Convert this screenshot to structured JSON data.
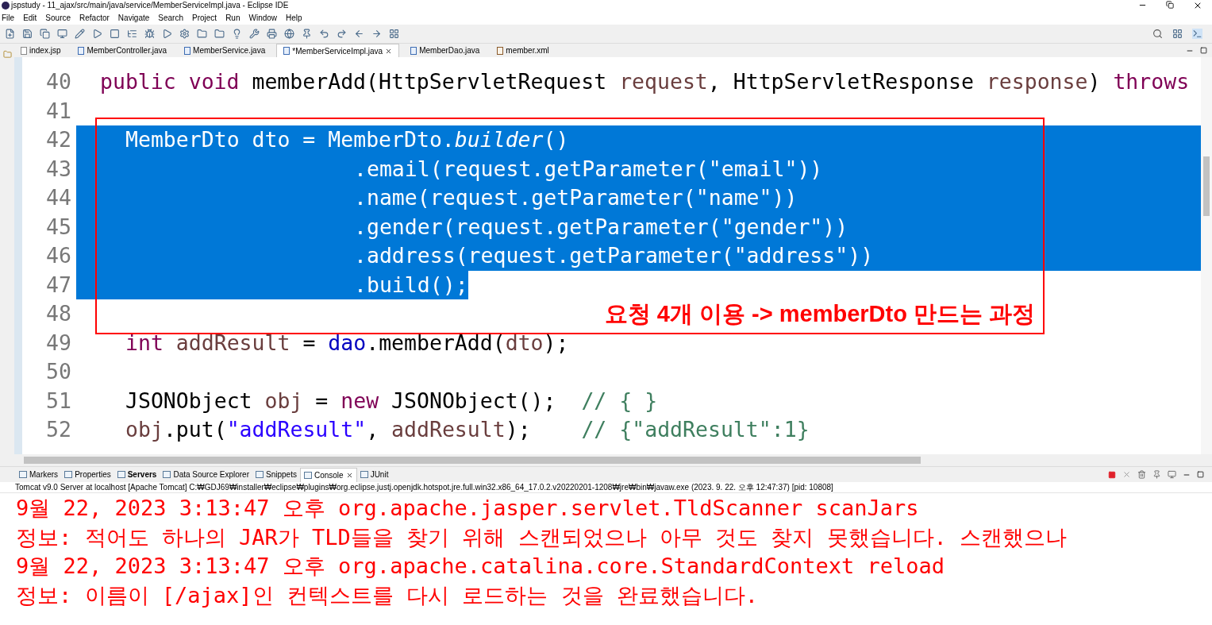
{
  "window": {
    "title": "jspstudy - 11_ajax/src/main/java/service/MemberServiceImpl.java - Eclipse IDE"
  },
  "menu": [
    "File",
    "Edit",
    "Source",
    "Refactor",
    "Navigate",
    "Search",
    "Project",
    "Run",
    "Window",
    "Help"
  ],
  "editor_tabs": [
    {
      "label": "index.jsp",
      "kind": "jsp",
      "selected": false
    },
    {
      "label": "MemberController.java",
      "kind": "java",
      "selected": false
    },
    {
      "label": "MemberService.java",
      "kind": "java",
      "selected": false
    },
    {
      "label": "*MemberServiceImpl.java",
      "kind": "java",
      "selected": true
    },
    {
      "label": "MemberDao.java",
      "kind": "java",
      "selected": false
    },
    {
      "label": "member.xml",
      "kind": "xml",
      "selected": false
    }
  ],
  "code_lines": [
    {
      "number": "40",
      "kind": "member",
      "selected": false,
      "tokens": [
        {
          "text": "public void ",
          "kind": "keyword"
        },
        {
          "text": "memberAdd(HttpServletRequest ",
          "kind": "plain"
        },
        {
          "text": "request",
          "kind": "param"
        },
        {
          "text": ", HttpServletResponse ",
          "kind": "plain"
        },
        {
          "text": "response",
          "kind": "param"
        },
        {
          "text": ") ",
          "kind": "plain"
        },
        {
          "text": "throws",
          "kind": "keyword"
        }
      ]
    },
    {
      "number": "41",
      "kind": "member",
      "selected": false
    },
    {
      "number": "42",
      "kind": "statement",
      "selected": true,
      "full_width": true,
      "tokens": [
        {
          "text": "MemberDto dto = MemberDto.",
          "kind": "plain"
        },
        {
          "text": "builder",
          "kind": "static"
        },
        {
          "text": "()",
          "kind": "plain"
        }
      ]
    },
    {
      "number": "43",
      "kind": "chain",
      "selected": true,
      "full_width": true,
      "tokens": [
        {
          "text": ".email(request.getParameter(\"email\"))",
          "kind": "plain"
        }
      ]
    },
    {
      "number": "44",
      "kind": "chain",
      "selected": true,
      "full_width": true,
      "tokens": [
        {
          "text": ".name(request.getParameter(\"name\"))",
          "kind": "plain"
        }
      ]
    },
    {
      "number": "45",
      "kind": "chain",
      "selected": true,
      "full_width": true,
      "tokens": [
        {
          "text": ".gender(request.getParameter(\"gender\"))",
          "kind": "plain"
        }
      ]
    },
    {
      "number": "46",
      "kind": "chain",
      "selected": true,
      "full_width": true,
      "tokens": [
        {
          "text": ".address(request.getParameter(\"address\"))",
          "kind": "plain"
        }
      ]
    },
    {
      "number": "47",
      "kind": "chain",
      "selected": true,
      "full_width": false,
      "tokens": [
        {
          "text": ".build();",
          "kind": "plain"
        }
      ]
    },
    {
      "number": "48",
      "kind": "member",
      "selected": false
    },
    {
      "number": "49",
      "kind": "statement",
      "selected": false,
      "tokens": [
        {
          "text": "int ",
          "kind": "keyword"
        },
        {
          "text": "addResult",
          "kind": "param"
        },
        {
          "text": " = ",
          "kind": "plain"
        },
        {
          "text": "dao",
          "kind": "field"
        },
        {
          "text": ".memberAdd(",
          "kind": "plain"
        },
        {
          "text": "dto",
          "kind": "param"
        },
        {
          "text": ");",
          "kind": "plain"
        }
      ]
    },
    {
      "number": "50",
      "kind": "member",
      "selected": false
    },
    {
      "number": "51",
      "kind": "statement",
      "selected": false,
      "tokens": [
        {
          "text": "JSONObject ",
          "kind": "plain"
        },
        {
          "text": "obj",
          "kind": "param"
        },
        {
          "text": " = ",
          "kind": "plain"
        },
        {
          "text": "new ",
          "kind": "keyword"
        },
        {
          "text": "JSONObject();  ",
          "kind": "plain"
        },
        {
          "text": "// { }",
          "kind": "comment"
        }
      ]
    },
    {
      "number": "52",
      "kind": "statement",
      "selected": false,
      "tokens": [
        {
          "text": "obj",
          "kind": "param"
        },
        {
          "text": ".put(",
          "kind": "plain"
        },
        {
          "text": "\"addResult\"",
          "kind": "string"
        },
        {
          "text": ", ",
          "kind": "plain"
        },
        {
          "text": "addResult",
          "kind": "param"
        },
        {
          "text": ");    ",
          "kind": "plain"
        },
        {
          "text": "// {\"addResult\":1}",
          "kind": "comment"
        }
      ]
    }
  ],
  "annotation": "요청 4개 이용 -> memberDto 만드는 과정",
  "bottom_tabs": [
    {
      "label": "Markers",
      "selected": false,
      "bold": false
    },
    {
      "label": "Properties",
      "selected": false,
      "bold": false
    },
    {
      "label": "Servers",
      "selected": false,
      "bold": true
    },
    {
      "label": "Data Source Explorer",
      "selected": false,
      "bold": false
    },
    {
      "label": "Snippets",
      "selected": false,
      "bold": false
    },
    {
      "label": "Console",
      "selected": true,
      "bold": false
    },
    {
      "label": "JUnit",
      "selected": false,
      "bold": false
    }
  ],
  "console_status": "Tomcat v9.0 Server at localhost [Apache Tomcat] C:₩GDJ69₩installer₩eclipse₩plugins₩org.eclipse.justj.openjdk.hotspot.jre.full.win32.x86_64_17.0.2.v20220201-1208₩jre₩bin₩javaw.exe  (2023. 9. 22. 오후 12:47:37) [pid: 10808]",
  "console_lines": [
    "9월 22, 2023 3:13:47 오후 org.apache.jasper.servlet.TldScanner scanJars",
    "정보: 적어도 하나의 JAR가 TLD들을 찾기 위해 스캔되었으나 아무 것도 찾지 못했습니다. 스캔했으나",
    "9월 22, 2023 3:13:47 오후 org.apache.catalina.core.StandardContext reload",
    "정보: 이름이 [/ajax]인 컨텍스트를 다시 로드하는 것을 완료했습니다."
  ]
}
